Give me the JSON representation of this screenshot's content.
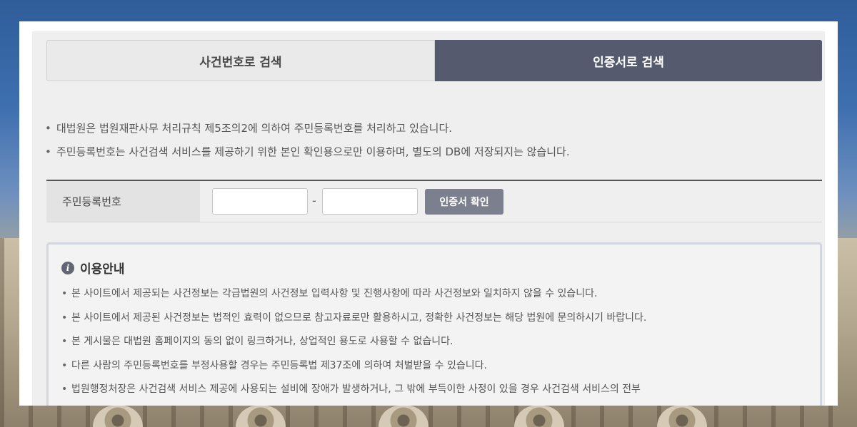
{
  "tabs": {
    "case_number": "사건번호로 검색",
    "certificate": "인증서로 검색"
  },
  "notices": [
    "대법원은 법원재판사무 처리규칙 제5조의2에 의하여 주민등록번호를 처리하고 있습니다.",
    "주민등록번호는 사건검색 서비스를 제공하기 위한 본인 확인용으로만 이용하며, 별도의 DB에 저장되지는 않습니다."
  ],
  "form": {
    "label": "주민등록번호",
    "rrn_first": "",
    "rrn_second": "",
    "separator": "-",
    "confirm_label": "인증서 확인"
  },
  "info": {
    "title": "이용안내",
    "icon": "info-icon",
    "items": [
      "본 사이트에서 제공되는 사건정보는 각급법원의 사건정보 입력사항 및 진행사항에 따라 사건정보와 일치하지 않을 수 있습니다.",
      "본 사이트에서 제공된 사건정보는 법적인 효력이 없으므로 참고자료로만 활용하시고, 정확한 사건정보는 해당 법원에 문의하시기 바랍니다.",
      "본 게시물은 대법원 홈페이지의 동의 없이 링크하거나, 상업적인 용도로 사용할 수 없습니다.",
      "다른 사람의 주민등록번호를 부정사용할 경우는 주민등록법 제37조에 의하여 처벌받을 수 있습니다.",
      "법원행정처장은 사건검색 서비스 제공에 사용되는 설비에 장애가 발생하거나, 그 밖에 부득이한 사정이 있을 경우 사건검색 서비스의 전부"
    ]
  },
  "colors": {
    "active_tab": "#555a6e",
    "confirm_button": "#7b7f8e",
    "panel_bg": "#efefef"
  }
}
